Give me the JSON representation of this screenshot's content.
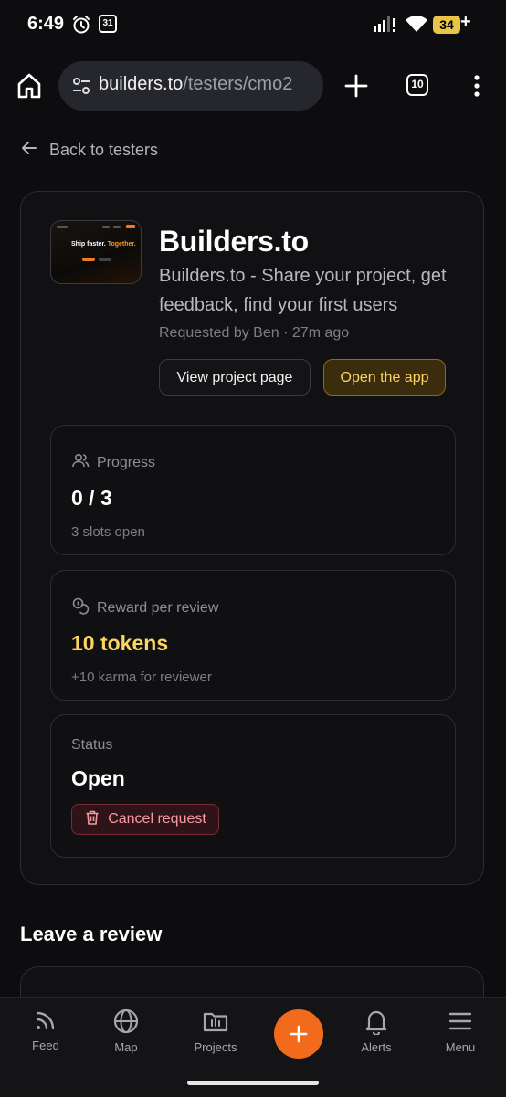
{
  "status_bar": {
    "time": "6:49",
    "calendar_day": "31",
    "battery": "34",
    "battery_color": "#e8c547",
    "icons": [
      "alarm-icon",
      "calendar-icon",
      "signal-icon",
      "wifi-icon",
      "battery-icon",
      "charging-plus-icon"
    ]
  },
  "browser": {
    "url_host": "builders.to",
    "url_path": "/testers/cmo2",
    "tab_count": "10",
    "icons": [
      "home-icon",
      "site-settings-icon",
      "new-tab-icon",
      "tab-switcher-icon",
      "more-vert-icon"
    ]
  },
  "back_link": {
    "label": "Back to testers",
    "icon": "arrow-left-icon"
  },
  "project": {
    "thumbnail": {
      "headline_a": "Ship faster.",
      "headline_b": "Together."
    },
    "title": "Builders.to",
    "description": "Builders.to - Share your project, get feedback, find your first users",
    "requested_by": "Requested by Ben",
    "separator": "·",
    "time_ago": "27m ago",
    "view_button": "View project page",
    "open_button": "Open the app"
  },
  "stats": {
    "progress": {
      "label": "Progress",
      "value": "0 / 3",
      "sub": "3 slots open",
      "icon": "users-icon"
    },
    "reward": {
      "label": "Reward per review",
      "value": "10 tokens",
      "sub": "+10 karma for reviewer",
      "icon": "coins-icon",
      "value_color": "#fbd561"
    },
    "status": {
      "label": "Status",
      "value": "Open",
      "cancel_button": "Cancel request",
      "cancel_icon": "trash-icon"
    }
  },
  "review": {
    "heading": "Leave a review"
  },
  "bottom_nav": {
    "items": [
      {
        "label": "Feed",
        "icon": "rss-icon"
      },
      {
        "label": "Map",
        "icon": "globe-icon"
      },
      {
        "label": "Projects",
        "icon": "folder-icon"
      },
      {
        "label": "Alerts",
        "icon": "bell-icon"
      },
      {
        "label": "Menu",
        "icon": "menu-icon"
      }
    ],
    "fab_icon": "plus-icon",
    "accent": "#f26a1b"
  }
}
